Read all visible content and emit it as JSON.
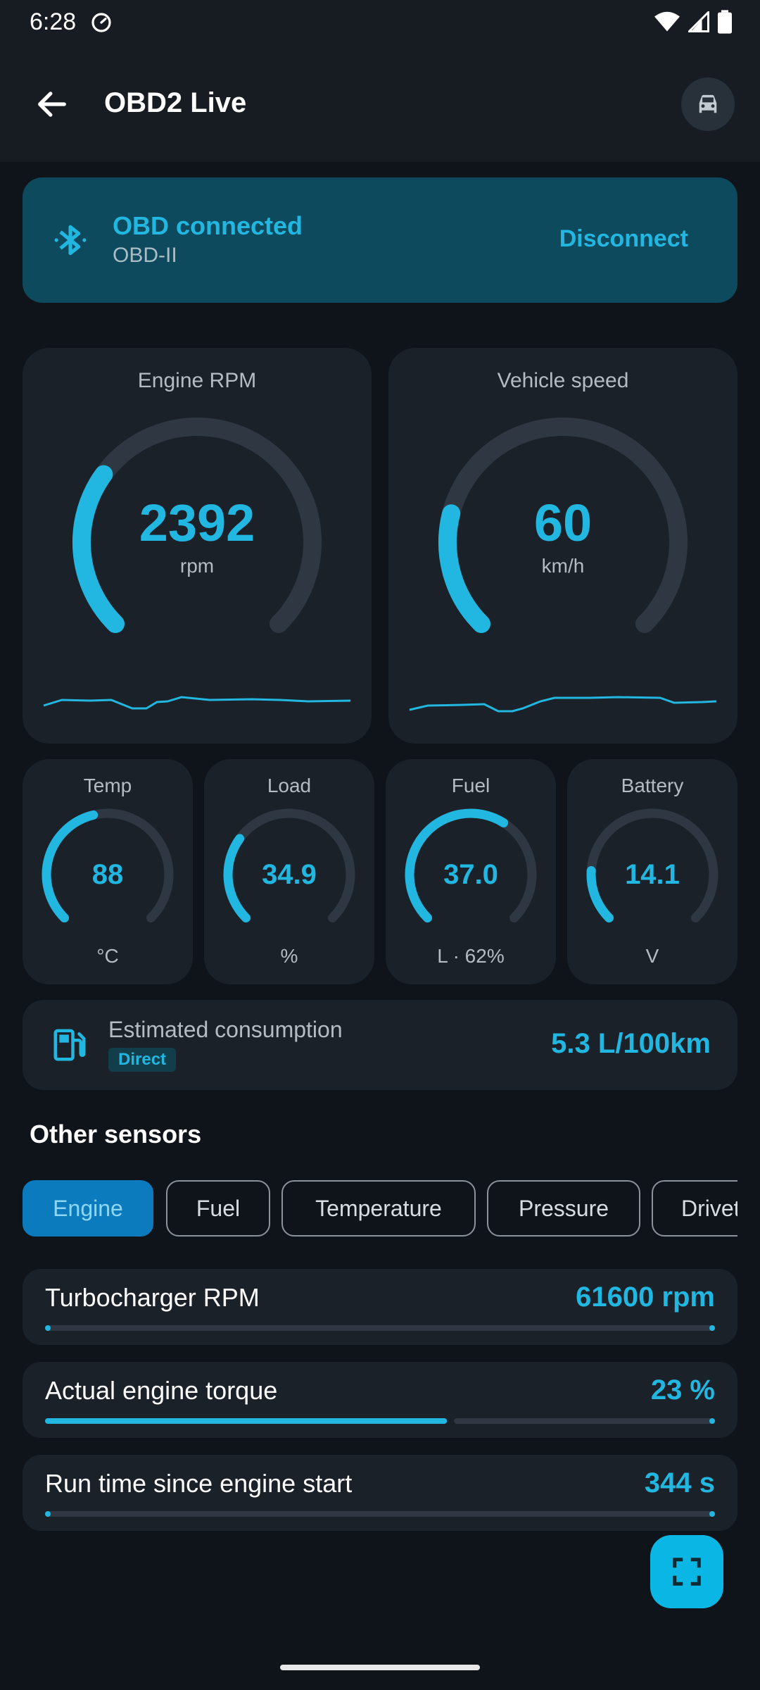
{
  "status": {
    "time": "6:28"
  },
  "appbar": {
    "title": "OBD2 Live"
  },
  "connection": {
    "title": "OBD connected",
    "subtitle": "OBD-II",
    "action": "Disconnect"
  },
  "gauges": {
    "rpm": {
      "title": "Engine RPM",
      "value": "2392",
      "unit": "rpm",
      "level": 0.3
    },
    "speed": {
      "title": "Vehicle speed",
      "value": "60",
      "unit": "km/h",
      "level": 0.22
    }
  },
  "small_gauges": [
    {
      "title": "Temp",
      "value": "88",
      "unit": "°C",
      "level": 0.45
    },
    {
      "title": "Load",
      "value": "34.9",
      "unit": "%",
      "level": 0.3
    },
    {
      "title": "Fuel",
      "value": "37.0",
      "unit": "L · 62%",
      "level": 0.62
    },
    {
      "title": "Battery",
      "value": "14.1",
      "unit": "V",
      "level": 0.18
    }
  ],
  "consumption": {
    "label": "Estimated consumption",
    "badge": "Direct",
    "value": "5.3 L/100km"
  },
  "other_sensors": {
    "title": "Other sensors",
    "chips": [
      "Engine",
      "Fuel",
      "Temperature",
      "Pressure",
      "Drivetrain"
    ],
    "active_chip": "Engine"
  },
  "sensors": [
    {
      "label": "Turbocharger RPM",
      "value": "61600 rpm",
      "level": 0.0
    },
    {
      "label": "Actual engine torque",
      "value": "23 %",
      "level": 0.6
    },
    {
      "label": "Run time since engine start",
      "value": "344 s",
      "level": 0.0
    }
  ],
  "colors": {
    "accent": "#21b7e0",
    "card": "#1a2129",
    "background": "#0f141a",
    "track": "#2f3742"
  }
}
